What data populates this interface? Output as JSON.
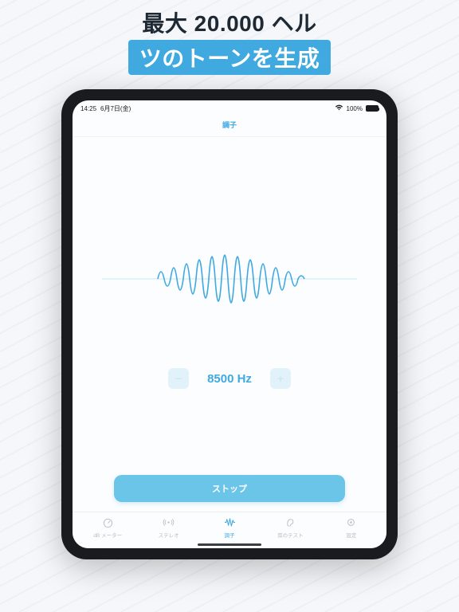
{
  "headline": {
    "line1": "最大 20.000 ヘル",
    "line2": "ツのトーンを生成"
  },
  "statusbar": {
    "time": "14:25",
    "date": "6月7日(金)",
    "battery_pct": "100%"
  },
  "navbar": {
    "title": "調子"
  },
  "frequency": {
    "minus_label": "−",
    "plus_label": "+",
    "value": "8500 Hz"
  },
  "stop_button": {
    "label": "ストップ"
  },
  "tabs": [
    {
      "label": "dB メーター",
      "icon": "db-meter-icon"
    },
    {
      "label": "ステレオ",
      "icon": "stereo-icon"
    },
    {
      "label": "調子",
      "icon": "wave-icon",
      "active": true
    },
    {
      "label": "耳のテスト",
      "icon": "ear-icon"
    },
    {
      "label": "設定",
      "icon": "settings-icon"
    }
  ],
  "colors": {
    "accent": "#3fa9e0",
    "accent_light": "#6ac5e8"
  }
}
